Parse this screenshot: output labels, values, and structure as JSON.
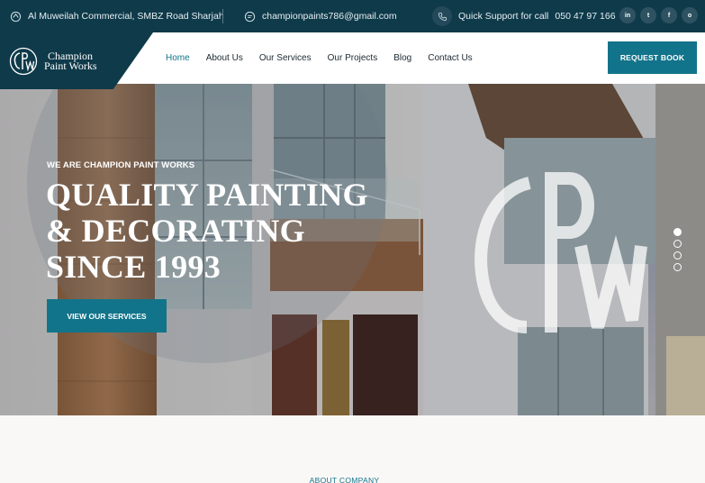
{
  "topbar": {
    "address": "Al Muweilah Commercial, SMBZ Road Sharjah",
    "email": "championpaints786@gmail.com",
    "support_label": "Quick Support for call",
    "phone": "050 47 97 166",
    "socials": [
      {
        "name": "linkedin",
        "glyph": "in"
      },
      {
        "name": "twitter",
        "glyph": "t"
      },
      {
        "name": "facebook",
        "glyph": "f"
      },
      {
        "name": "instagram",
        "glyph": "o"
      }
    ]
  },
  "brand": {
    "monogram": "CPW",
    "line1": "Champion",
    "line2": "Paint Works"
  },
  "nav": {
    "items": [
      "Home",
      "About Us",
      "Our Services",
      "Our Projects",
      "Blog",
      "Contact Us"
    ],
    "active": "Home",
    "cta": "REQUEST BOOK"
  },
  "hero": {
    "subtitle": "WE ARE CHAMPION PAINT WORKS",
    "title_line1": "QUALITY PAINTING",
    "title_line2": "& DECORATING",
    "title_line3": "SINCE 1993",
    "button": "VIEW OUR SERVICES",
    "watermark": "CPW",
    "slides": 4,
    "active_slide": 1
  },
  "about": {
    "label": "ABOUT COMPANY"
  },
  "colors": {
    "dark": "#0f3a4a",
    "accent": "#12748a"
  }
}
